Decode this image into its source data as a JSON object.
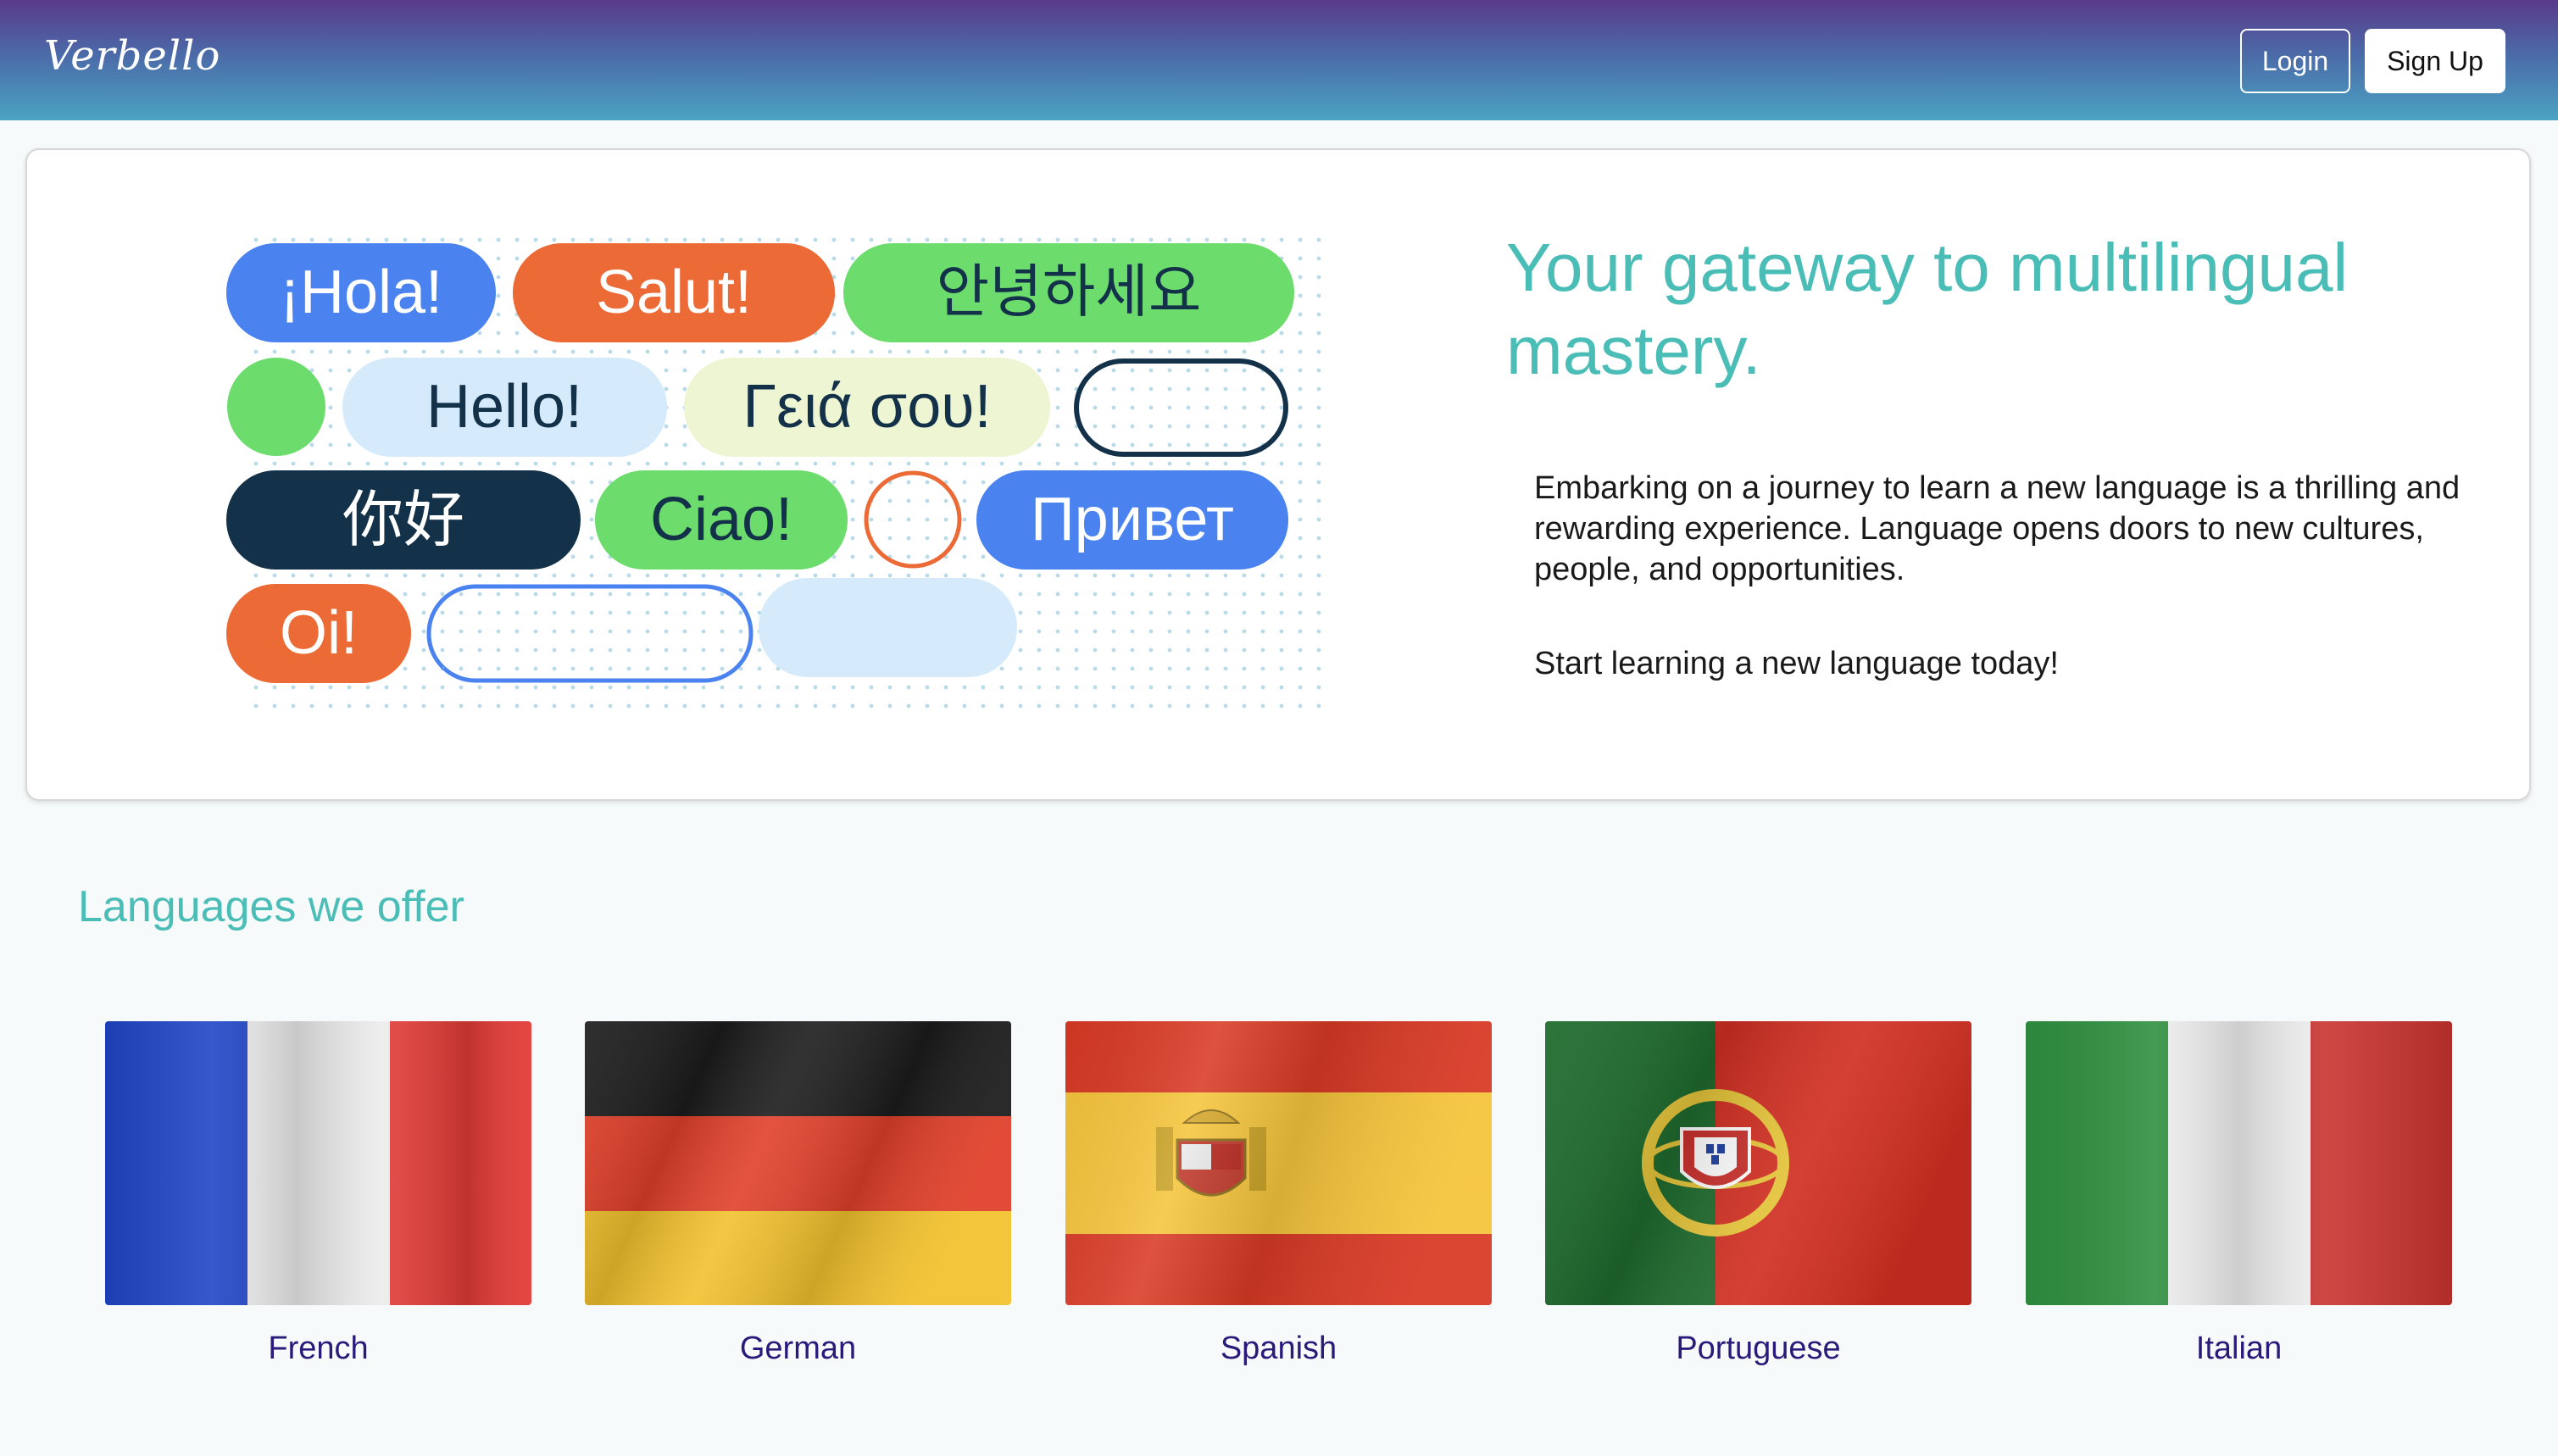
{
  "header": {
    "logo": "Verbello",
    "login_label": "Login",
    "signup_label": "Sign Up"
  },
  "hero": {
    "greetings": [
      "¡Hola!",
      "Salut!",
      "안녕하세요",
      "Hello!",
      "Γειά σου!",
      "你好",
      "Ciao!",
      "Привет",
      "Oi!"
    ],
    "title": "Your gateway to multilingual mastery.",
    "paragraph": "Embarking on a journey to learn a new language is a thrilling and rewarding experience. Language opens doors to new cultures, people, and opportunities.",
    "cta": "Start learning a new language today!"
  },
  "languages": {
    "title": "Languages we offer",
    "items": [
      {
        "name": "French",
        "flag": "france-flag"
      },
      {
        "name": "German",
        "flag": "germany-flag"
      },
      {
        "name": "Spanish",
        "flag": "spain-flag"
      },
      {
        "name": "Portuguese",
        "flag": "portugal-flag"
      },
      {
        "name": "Italian",
        "flag": "italy-flag"
      }
    ]
  },
  "colors": {
    "accent": "#4bbdb7",
    "blue": "#4a82f0",
    "orange": "#ec6a35",
    "green": "#6cdc6c",
    "navy": "#133149",
    "light_blue": "#d5ebfb",
    "pale_yellow": "#eef5d2",
    "link": "#2a1a7a"
  }
}
